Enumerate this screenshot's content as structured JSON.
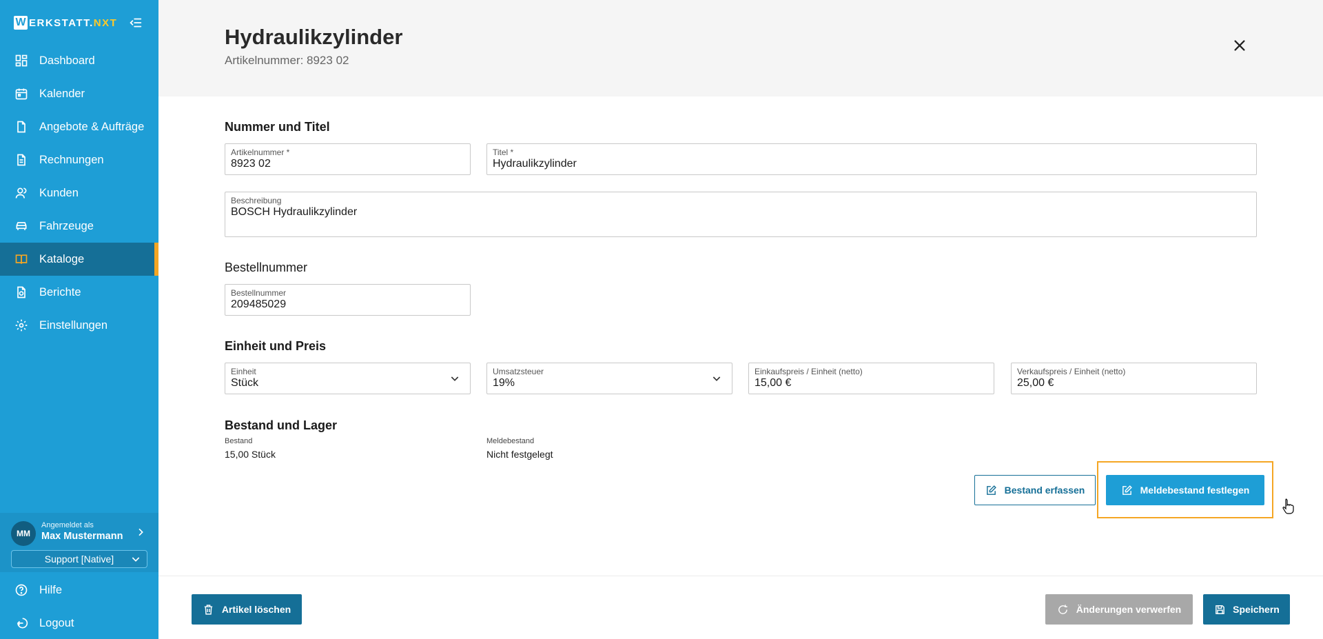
{
  "app": {
    "logo_letter": "W",
    "logo_main": "ERKSTATT.",
    "logo_accent": "NXT"
  },
  "sidebar": {
    "items": [
      {
        "label": "Dashboard",
        "icon": "dashboard-icon"
      },
      {
        "label": "Kalender",
        "icon": "calendar-icon"
      },
      {
        "label": "Angebote & Aufträge",
        "icon": "document-icon"
      },
      {
        "label": "Rechnungen",
        "icon": "invoice-icon"
      },
      {
        "label": "Kunden",
        "icon": "users-icon"
      },
      {
        "label": "Fahrzeuge",
        "icon": "car-icon"
      },
      {
        "label": "Kataloge",
        "icon": "book-icon",
        "active": true
      },
      {
        "label": "Berichte",
        "icon": "report-icon"
      },
      {
        "label": "Einstellungen",
        "icon": "gear-icon"
      }
    ],
    "user": {
      "initials": "MM",
      "caption": "Angemeldet als",
      "name": "Max Mustermann"
    },
    "support": "Support [Native]",
    "bottom": [
      {
        "label": "Hilfe",
        "icon": "help-icon"
      },
      {
        "label": "Logout",
        "icon": "logout-icon"
      }
    ],
    "colors": {
      "background": "#1e9ed6",
      "active": "#156f97",
      "active_marker": "#f5a623"
    }
  },
  "header": {
    "title": "Hydraulikzylinder",
    "subtitle": "Artikelnummer: 8923 02"
  },
  "sections": {
    "nummer_titel": {
      "title": "Nummer und Titel",
      "artikelnummer_label": "Artikelnummer *",
      "artikelnummer_value": "8923 02",
      "titel_label": "Titel *",
      "titel_value": "Hydraulikzylinder",
      "beschreibung_label": "Beschreibung",
      "beschreibung_value": "BOSCH Hydraulikzylinder"
    },
    "bestellnummer": {
      "title": "Bestellnummer",
      "label": "Bestellnummer",
      "value": "209485029"
    },
    "einheit_preis": {
      "title": "Einheit und Preis",
      "einheit_label": "Einheit",
      "einheit_value": "Stück",
      "ust_label": "Umsatzsteuer",
      "ust_value": "19%",
      "ek_label": "Einkaufspreis / Einheit (netto)",
      "ek_value": "15,00 €",
      "vk_label": "Verkaufspreis / Einheit (netto)",
      "vk_value": "25,00 €"
    },
    "bestand_lager": {
      "title": "Bestand und Lager",
      "bestand_label": "Bestand",
      "bestand_value": "15,00 Stück",
      "melde_label": "Meldebestand",
      "melde_value": "Nicht festgelegt",
      "btn_bestand": "Bestand erfassen",
      "btn_melde": "Meldebestand festlegen"
    }
  },
  "footer": {
    "delete": "Artikel löschen",
    "discard": "Änderungen verwerfen",
    "save": "Speichern"
  }
}
